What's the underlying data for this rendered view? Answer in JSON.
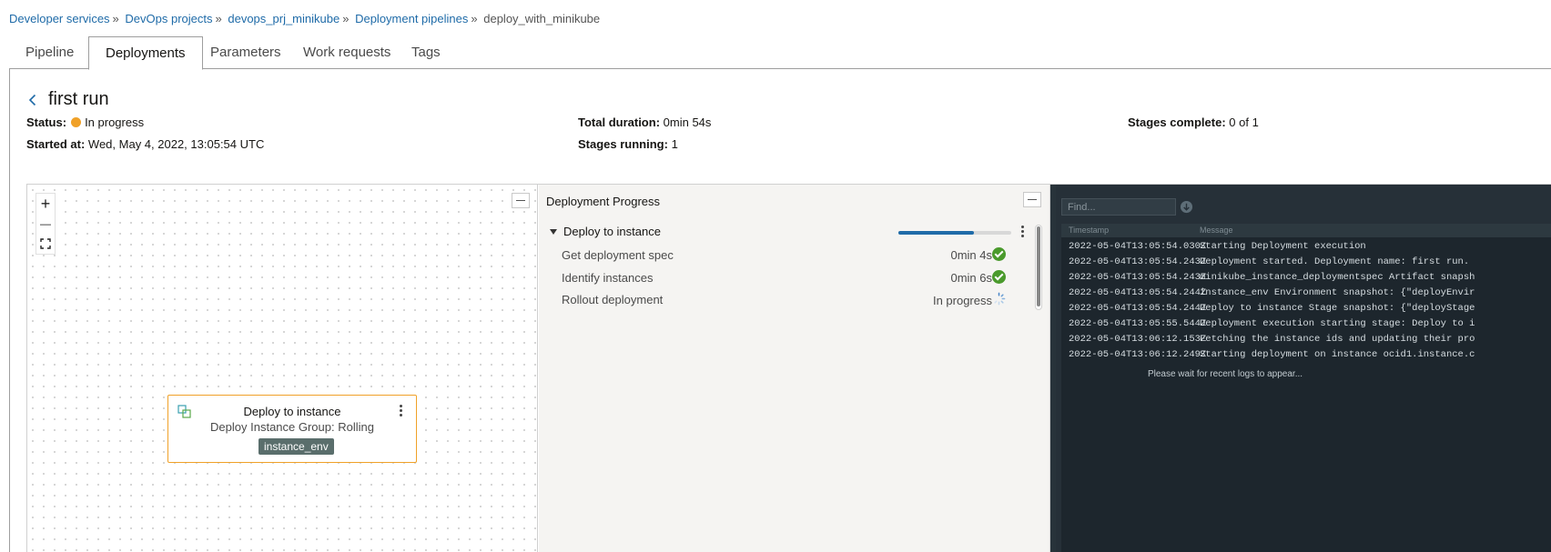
{
  "breadcrumb": {
    "items": [
      "Developer services",
      "DevOps projects",
      "devops_prj_minikube",
      "Deployment pipelines"
    ],
    "current": "deploy_with_minikube",
    "separator": "»"
  },
  "tabs": [
    "Pipeline",
    "Deployments",
    "Parameters",
    "Work requests",
    "Tags"
  ],
  "header": {
    "title": "first run",
    "status_label": "Status:",
    "status_value": "In progress",
    "started_label": "Started at:",
    "started_value": "Wed, May 4, 2022, 13:05:54 UTC",
    "duration_label": "Total duration:",
    "duration_value": "0min 54s",
    "running_label": "Stages running:",
    "running_value": "1",
    "complete_label": "Stages complete:",
    "complete_value": "0 of 1"
  },
  "canvas": {
    "zoom_in": "+",
    "zoom_out": "—",
    "node": {
      "title": "Deploy to instance",
      "subtitle": "Deploy Instance Group: Rolling",
      "tag": "instance_env"
    }
  },
  "progress": {
    "title": "Deployment Progress",
    "stage": "Deploy to instance",
    "stage_progress_fraction": 0.67,
    "steps": [
      {
        "name": "Get deployment spec",
        "duration": "0min 4s",
        "state": "done"
      },
      {
        "name": "Identify instances",
        "duration": "0min 6s",
        "state": "done"
      },
      {
        "name": "Rollout deployment",
        "duration": "In progress",
        "state": "running"
      }
    ]
  },
  "logs": {
    "find_placeholder": "Find...",
    "col_timestamp": "Timestamp",
    "col_message": "Message",
    "rows": [
      {
        "ts": "2022-05-04T13:05:54.030Z",
        "msg": "Starting Deployment execution"
      },
      {
        "ts": "2022-05-04T13:05:54.243Z",
        "msg": "Deployment started. Deployment name: first run."
      },
      {
        "ts": "2022-05-04T13:05:54.243Z",
        "msg": "minikube_instance_deploymentspec Artifact snapsh"
      },
      {
        "ts": "2022-05-04T13:05:54.244Z",
        "msg": "instance_env Environment snapshot: {\"deployEnvir"
      },
      {
        "ts": "2022-05-04T13:05:54.244Z",
        "msg": "Deploy to instance Stage snapshot: {\"deployStage"
      },
      {
        "ts": "2022-05-04T13:05:55.544Z",
        "msg": "Deployment execution starting stage: Deploy to i"
      },
      {
        "ts": "2022-05-04T13:06:12.153Z",
        "msg": "Fetching the instance ids and updating their pro"
      },
      {
        "ts": "2022-05-04T13:06:12.249Z",
        "msg": "Starting deployment on instance ocid1.instance.c"
      }
    ],
    "wait_message": "Please wait for recent logs to appear..."
  }
}
